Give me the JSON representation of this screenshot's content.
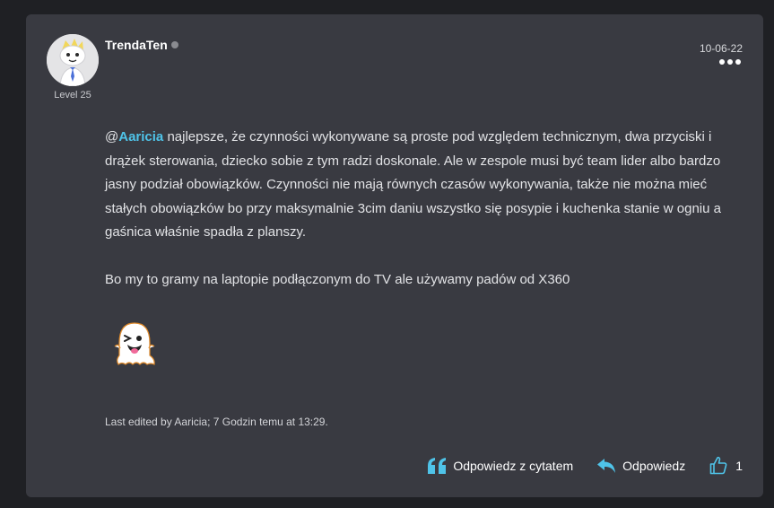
{
  "post": {
    "author": {
      "username": "TrendaTen",
      "level": "Level 25",
      "status": "offline"
    },
    "date": "10-06-22",
    "mention": "Aaricia",
    "paragraph1_rest": " najlepsze, że czynności wykonywane są proste pod względem technicznym, dwa przyciski i drążek sterowania, dziecko sobie z tym radzi doskonale. Ale w zespole musi być team lider albo bardzo jasny podział obowiązków. Czynności nie mają równych czasów wykonywania, także nie można mieć stałych obowiązków bo przy maksymalnie 3cim daniu wszystko się posypie i kuchenka stanie w ogniu a gaśnica właśnie spadła z planszy.",
    "paragraph2": "Bo my to gramy na laptopie podłączonym do TV ale używamy padów od X360",
    "emoji": "ghost-tongue-wink",
    "edited_note": "Last edited by Aaricia; 7 Godzin temu at 13:29."
  },
  "actions": {
    "quote_reply": "Odpowiedz z cytatem",
    "reply": "Odpowiedz",
    "like_count": "1"
  },
  "colors": {
    "page_bg": "#1f2024",
    "card_bg": "#393a41",
    "accent": "#4fc3e8",
    "text": "#e2e3e6"
  }
}
